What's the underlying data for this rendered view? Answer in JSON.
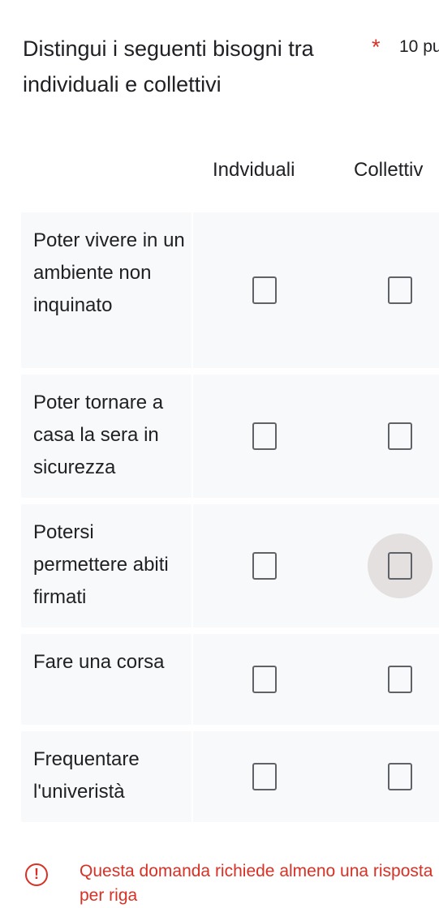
{
  "question": {
    "title": "Distingui i seguenti bisogni tra individuali e collettivi",
    "required_mark": "*",
    "points": "10 pu"
  },
  "columns": [
    "Indviduali",
    "Collettiv"
  ],
  "rows": [
    {
      "label": "Poter vivere in un ambiente non inquinato"
    },
    {
      "label": "Poter tornare a casa la sera in sicurezza"
    },
    {
      "label": "Potersi permettere abiti firmati"
    },
    {
      "label": "Fare una corsa"
    },
    {
      "label": "Frequentare l'univeristà"
    }
  ],
  "error": {
    "icon": "exclamation-icon",
    "message": "Questa domanda richiede almeno una risposta per riga"
  },
  "colors": {
    "error": "#d93025",
    "row_bg": "#f8f9fa"
  }
}
